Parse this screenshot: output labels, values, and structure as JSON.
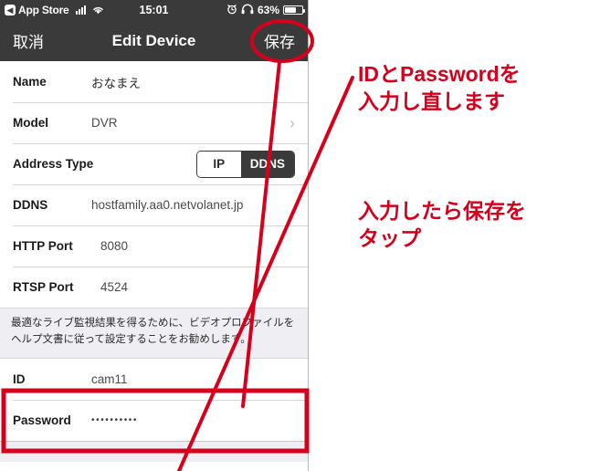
{
  "phone": {
    "statusbar": {
      "back_icon": "back-chevron-icon",
      "carrier_label": "App Store",
      "signal_icon": "signal-bars-icon",
      "wifi_icon": "wifi-icon",
      "time": "15:01",
      "alarm_icon": "alarm-clock-icon",
      "headphones_icon": "headphones-icon",
      "battery_percent": "63%",
      "battery_icon": "battery-icon"
    },
    "navbar": {
      "cancel_label": "取消",
      "title": "Edit Device",
      "save_label": "保存"
    },
    "form": {
      "rows": [
        {
          "label": "Name",
          "value": "おなまえ"
        },
        {
          "label": "Model",
          "value": "DVR",
          "chevron": "›"
        },
        {
          "label": "Address Type",
          "seg_left": "IP",
          "seg_right": "DDNS"
        },
        {
          "label": "DDNS",
          "value": "hostfamily.aa0.netvolanet.jp"
        },
        {
          "label": "HTTP Port",
          "value": "8080"
        },
        {
          "label": "RTSP Port",
          "value": "4524"
        }
      ],
      "note": "最適なライブ監視結果を得るために、ビデオプロファイルをヘルプ文書に従って設定することをお勧めします。",
      "credentials": [
        {
          "label": "ID",
          "value": "cam11"
        },
        {
          "label": "Password",
          "value": "••••••••••"
        }
      ]
    }
  },
  "annotations": {
    "accent_color": "#d6001c",
    "note_1": "IDとPasswordを\n入力し直します",
    "note_2": "入力したら保存を\nタップ",
    "save_highlight_ellipse": "ellipse-around-save-button",
    "credentials_highlight_box": "rectangle-around-id-password"
  }
}
